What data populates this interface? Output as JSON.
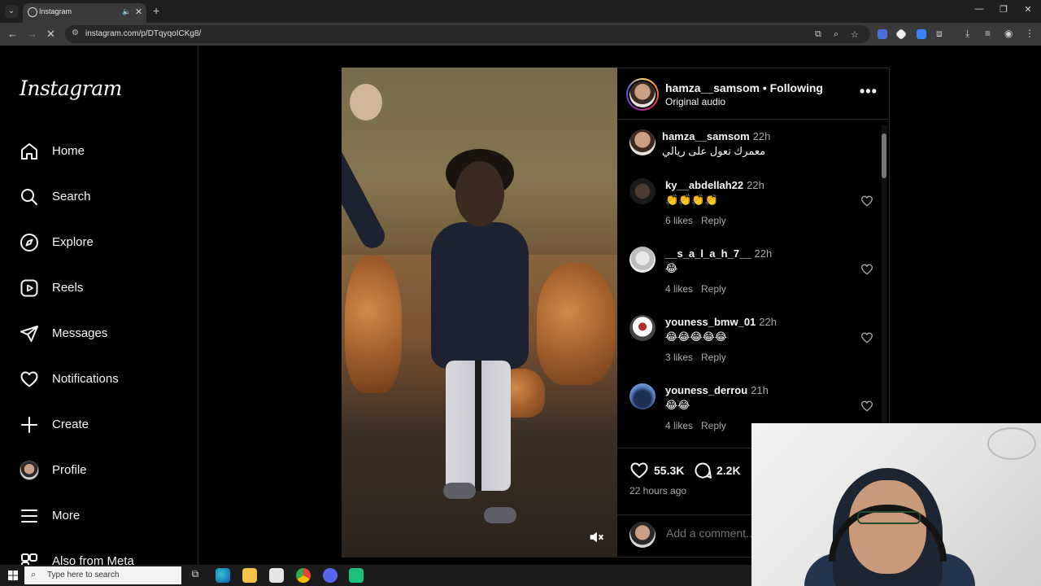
{
  "browser": {
    "tab_title": "Instagram",
    "url": "instagram.com/p/DTqyqoICKg8/"
  },
  "sidebar": {
    "logo": "Instagram",
    "items": [
      {
        "label": "Home",
        "icon": "home-icon"
      },
      {
        "label": "Search",
        "icon": "search-icon"
      },
      {
        "label": "Explore",
        "icon": "compass-icon"
      },
      {
        "label": "Reels",
        "icon": "reels-icon"
      },
      {
        "label": "Messages",
        "icon": "messages-icon"
      },
      {
        "label": "Notifications",
        "icon": "heart-icon"
      },
      {
        "label": "Create",
        "icon": "plus-icon"
      },
      {
        "label": "Profile",
        "icon": "avatar"
      },
      {
        "label": "More",
        "icon": "hamburger-icon"
      },
      {
        "label": "Also from Meta",
        "icon": "meta-icon"
      }
    ]
  },
  "post": {
    "author": "hamza__samsom",
    "follow_status": "• Following",
    "audio": "Original audio",
    "caption": {
      "user": "hamza__samsom",
      "time": "22h",
      "text": "معمرك تعول على ريالي"
    },
    "comments": [
      {
        "user": "ky__abdellah22",
        "time": "22h",
        "text": "👏👏👏👏",
        "likes": "6 likes",
        "reply": "Reply"
      },
      {
        "user": "__s_a_l_a_h_7__",
        "time": "22h",
        "text": "😂",
        "likes": "4 likes",
        "reply": "Reply"
      },
      {
        "user": "youness_bmw_01",
        "time": "22h",
        "text": "😂😂😂😂😂",
        "likes": "3 likes",
        "reply": "Reply"
      },
      {
        "user": "youness_derrou",
        "time": "21h",
        "text": "😂😂",
        "likes": "4 likes",
        "reply": "Reply"
      }
    ],
    "like_count": "55.3K",
    "comment_count": "2.2K",
    "posted": "22 hours ago",
    "add_comment_placeholder": "Add a comment..."
  },
  "taskbar": {
    "search_placeholder": "Type here to search"
  },
  "colors": {
    "background": "#000000",
    "text": "#f5f5f5",
    "muted": "#a8a8a8",
    "divider": "#262626"
  }
}
